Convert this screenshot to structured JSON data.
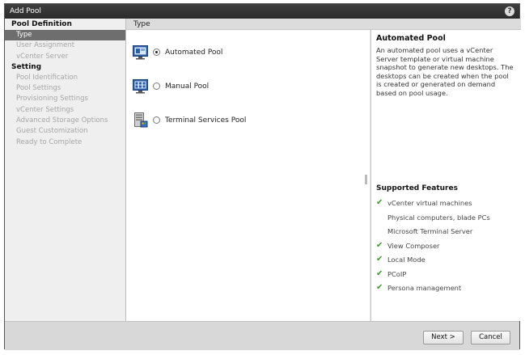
{
  "window": {
    "title": "Add Pool",
    "help_glyph": "?"
  },
  "nav": {
    "sections": [
      {
        "label": "Pool Definition",
        "items": [
          "Type",
          "User Assignment",
          "vCenter Server"
        ]
      },
      {
        "label": "Setting",
        "items": [
          "Pool Identification",
          "Pool Settings",
          "Provisioning Settings",
          "vCenter Settings",
          "Advanced Storage Options",
          "Guest Customization",
          "Ready to Complete"
        ]
      }
    ],
    "selected": "Type"
  },
  "content": {
    "header": "Type",
    "options": [
      {
        "label": "Automated Pool",
        "selected": true,
        "icon": "desktop-template-icon"
      },
      {
        "label": "Manual Pool",
        "selected": false,
        "icon": "desktop-grid-icon"
      },
      {
        "label": "Terminal Services Pool",
        "selected": false,
        "icon": "server-icon"
      }
    ]
  },
  "info": {
    "title": "Automated Pool",
    "description": "An automated pool uses a vCenter Server template or virtual machine snapshot to generate new desktops. The desktops can be created when the pool is created or generated on demand based on pool usage.",
    "features_title": "Supported Features",
    "features": [
      {
        "label": "vCenter virtual machines",
        "supported": true
      },
      {
        "label": "Physical computers, blade PCs",
        "supported": false
      },
      {
        "label": "Microsoft Terminal Server",
        "supported": false
      },
      {
        "label": "View Composer",
        "supported": true
      },
      {
        "label": "Local Mode",
        "supported": true
      },
      {
        "label": "PCoIP",
        "supported": true
      },
      {
        "label": "Persona management",
        "supported": true
      }
    ]
  },
  "footer": {
    "next_label": "Next >",
    "cancel_label": "Cancel"
  },
  "colors": {
    "check": "#3a9a2a",
    "nav_selected": "#6e6e6e",
    "titlebar": "#333333"
  }
}
